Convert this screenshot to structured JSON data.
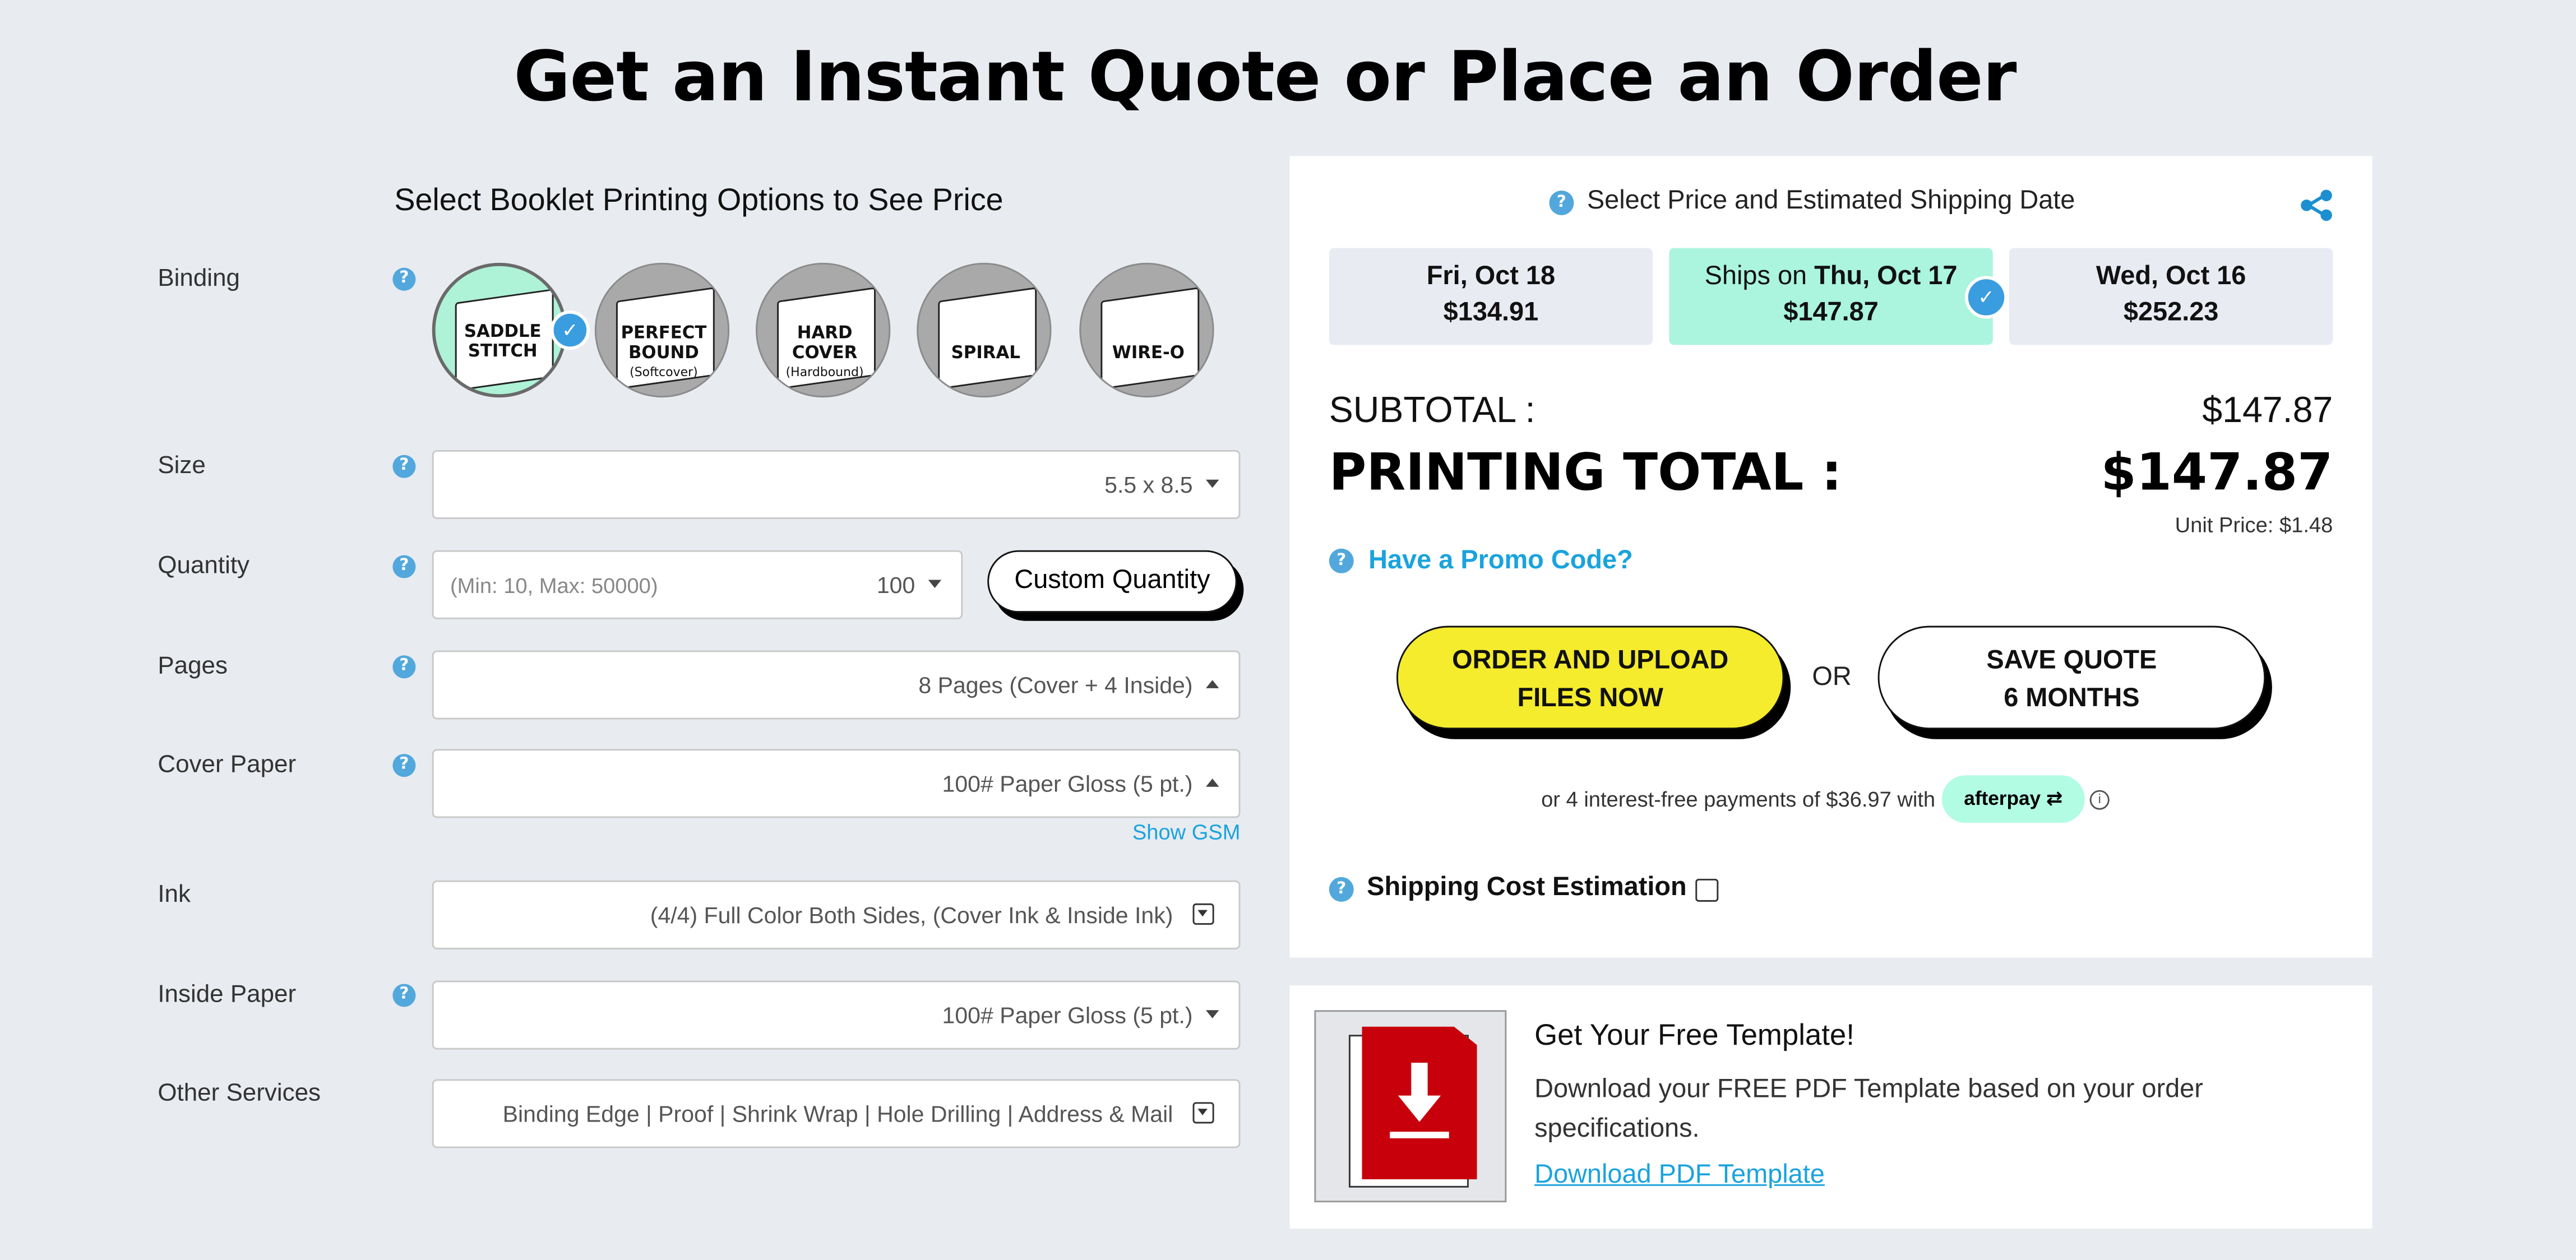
{
  "page": {
    "title": "Get an Instant Quote or Place an Order"
  },
  "options": {
    "section_title": "Select Booklet Printing Options to See Price",
    "binding": {
      "label": "Binding",
      "items": [
        {
          "line1": "SADDLE",
          "line2": "STITCH",
          "sub": "",
          "selected": true
        },
        {
          "line1": "PERFECT",
          "line2": "BOUND",
          "sub": "(Softcover)",
          "selected": false
        },
        {
          "line1": "HARD",
          "line2": "COVER",
          "sub": "(Hardbound)",
          "selected": false
        },
        {
          "line1": "SPIRAL",
          "line2": "",
          "sub": "",
          "selected": false
        },
        {
          "line1": "WIRE-O",
          "line2": "",
          "sub": "",
          "selected": false
        }
      ]
    },
    "size": {
      "label": "Size",
      "value": "5.5 x 8.5"
    },
    "quantity": {
      "label": "Quantity",
      "placeholder": "(Min: 10, Max: 50000)",
      "value": "100",
      "custom_button": "Custom Quantity"
    },
    "pages": {
      "label": "Pages",
      "value": "8 Pages (Cover + 4 Inside)"
    },
    "cover_paper": {
      "label": "Cover Paper",
      "value": "100# Paper Gloss (5 pt.)",
      "show_gsm": "Show GSM"
    },
    "ink": {
      "label": "Ink",
      "value": "(4/4) Full Color Both Sides, (Cover Ink & Inside Ink)"
    },
    "inside_paper": {
      "label": "Inside Paper",
      "value": "100# Paper Gloss (5 pt.)"
    },
    "other_services": {
      "label": "Other Services",
      "value": "Binding Edge | Proof | Shrink Wrap | Hole Drilling | Address & Mail"
    }
  },
  "pricing": {
    "header": "Select Price and Estimated Shipping Date",
    "dates": [
      {
        "prefix": "",
        "date": "Fri, Oct 18",
        "price": "$134.91",
        "selected": false
      },
      {
        "prefix": "Ships on ",
        "date": "Thu, Oct 17",
        "price": "$147.87",
        "selected": true
      },
      {
        "prefix": "",
        "date": "Wed, Oct 16",
        "price": "$252.23",
        "selected": false
      }
    ],
    "subtotal_label": "SUBTOTAL :",
    "subtotal_value": "$147.87",
    "total_label": "PRINTING TOTAL :",
    "total_value": "$147.87",
    "unit_price": "Unit Price: $1.48",
    "promo": "Have a Promo Code?",
    "order_btn_line1": "ORDER AND UPLOAD",
    "order_btn_line2": "FILES NOW",
    "or": "OR",
    "save_btn_line1": "SAVE QUOTE",
    "save_btn_line2": "6 MONTHS",
    "installments": "or 4 interest-free payments of $36.97 with",
    "afterpay": "afterpay",
    "shipping_estimation": "Shipping Cost Estimation"
  },
  "template": {
    "title": "Get Your Free Template!",
    "desc_line1": "Download your FREE PDF Template based on your order",
    "desc_line2": "specifications.",
    "link": "Download PDF Template"
  },
  "colors": {
    "accent_blue": "#1aa3dd",
    "selected_green": "#abf4de",
    "order_yellow": "#f4ec2c",
    "pdf_red": "#c8000c"
  }
}
